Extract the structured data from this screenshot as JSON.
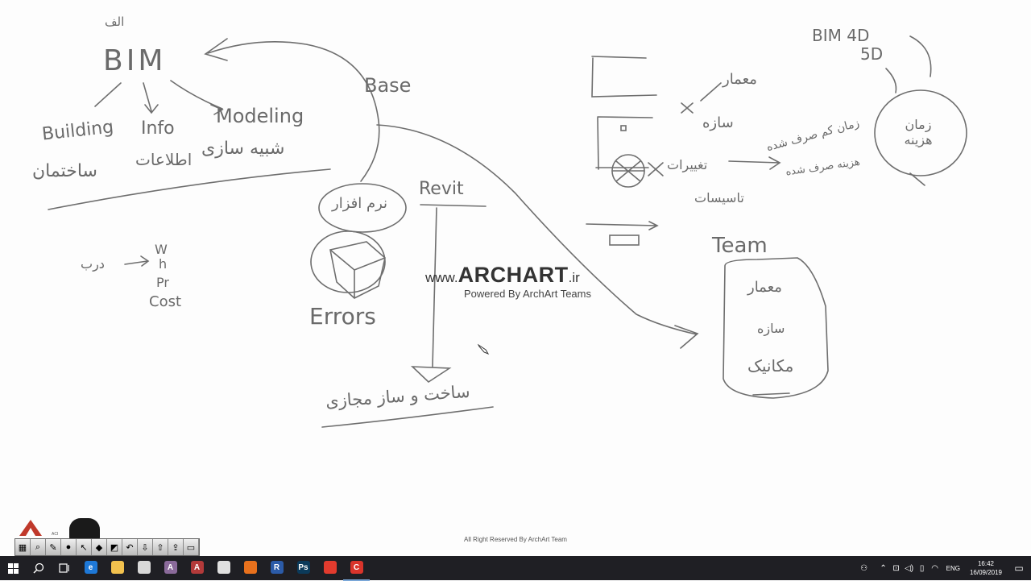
{
  "watermark": {
    "site_prefix": "www.",
    "site_name": "ARCHART",
    "site_suffix": ".ir",
    "powered_by": "Powered By ArchArt Teams"
  },
  "footer_note": "All Right Reserved By ArchArt Team",
  "sketch": {
    "bim": "BIM",
    "bim_fa": "الف",
    "building": "Building",
    "info": "Info",
    "modeling": "Modeling",
    "fa_construction": "ساختمان",
    "fa_info": "اطلاعات",
    "fa_sim": "شبیه سازی",
    "base": "Base",
    "fa_software": "نرم افزار",
    "revit": "Revit",
    "errors": "Errors",
    "fa_virtual": "ساخت و ساز مجازی",
    "fa_door": "درب",
    "w": "W",
    "h": "h",
    "pr": "Pr",
    "cost": "Cost",
    "bim4d": "BIM 4D",
    "bim5d": "5D",
    "fa_time_cost": "زمان هزینه",
    "fa_arch": "معمار",
    "fa_struct": "سازه",
    "fa_time_spent": "زمان کم صرف شده",
    "fa_cost_spent": "هزینه صرف شده",
    "fa_changes": "تغییرات",
    "fa_install": "تاسیسات",
    "team": "Team",
    "team_arch": "معمار",
    "team_struct": "سازه",
    "team_mech": "مکانیک"
  },
  "taskbar": {
    "apps": [
      {
        "name": "edge",
        "glyph": "e",
        "color": "#1e78d7"
      },
      {
        "name": "explorer",
        "glyph": "",
        "color": "#f2c14e"
      },
      {
        "name": "mail",
        "glyph": "",
        "color": "#d8d8d8"
      },
      {
        "name": "archicad",
        "glyph": "A",
        "color": "#8a6a9a"
      },
      {
        "name": "autocad",
        "glyph": "A",
        "color": "#b33a3a"
      },
      {
        "name": "maps",
        "glyph": "",
        "color": "#e0e0e0"
      },
      {
        "name": "firefox",
        "glyph": "",
        "color": "#e8711d"
      },
      {
        "name": "revit",
        "glyph": "R",
        "color": "#2b5ba8"
      },
      {
        "name": "photoshop",
        "glyph": "Ps",
        "color": "#0b3a5a"
      },
      {
        "name": "recorder",
        "glyph": "",
        "color": "#e23b2e"
      },
      {
        "name": "camtasia",
        "glyph": "C",
        "color": "#d9342b"
      }
    ],
    "lang": "ENG",
    "time": "16:42",
    "date": "16/09/2019"
  }
}
